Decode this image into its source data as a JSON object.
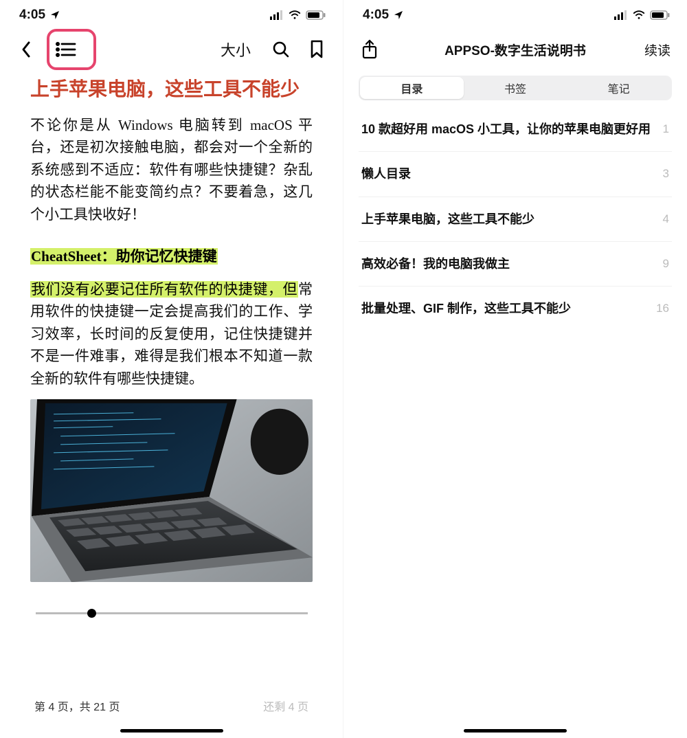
{
  "status": {
    "time": "4:05"
  },
  "left": {
    "toolbar": {
      "fontsize_label": "大小"
    },
    "title": "上手苹果电脑，这些工具不能少",
    "para1": "不论你是从 Windows 电脑转到 macOS 平台，还是初次接触电脑，都会对一个全新的系统感到不适应：软件有哪些快捷键？杂乱的状态栏能不能变简约点？不要着急，这几个小工具快收好！",
    "subheading": "CheatSheet：助你记忆快捷键",
    "para2_mark": "我们没有必要记住所有软件的快捷键，但",
    "para2_rest": "常用软件的快捷键一定会提高我们的工作、学习效率，长时间的反复使用，记住快捷键并不是一件难事，难得是我们根本不知道一款全新的软件有哪些快捷键。",
    "current_page_text": "第 4 页，共 21 页",
    "remaining_text": "还剩 4 页"
  },
  "right": {
    "title": "APPSO-数字生活说明书",
    "continue": "续读",
    "tabs": {
      "toc": "目录",
      "bookmarks": "书签",
      "notes": "笔记"
    },
    "items": [
      {
        "title": "10 款超好用 macOS 小工具，让你的苹果电脑更好用",
        "page": "1"
      },
      {
        "title": "懒人目录",
        "page": "3"
      },
      {
        "title": "上手苹果电脑，这些工具不能少",
        "page": "4"
      },
      {
        "title": "高效必备！我的电脑我做主",
        "page": "9"
      },
      {
        "title": "批量处理、GIF 制作，这些工具不能少",
        "page": "16"
      }
    ]
  }
}
